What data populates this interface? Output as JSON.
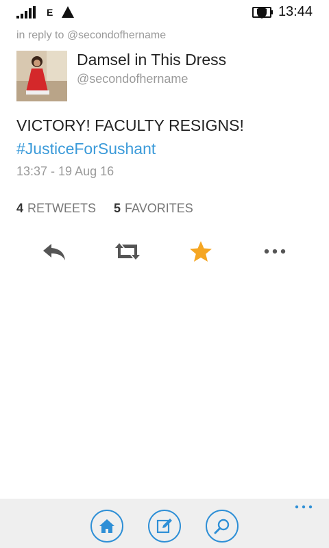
{
  "status_bar": {
    "network_type": "E",
    "time": "13:44",
    "icons": [
      "signal-strength-icon",
      "triangle-icon",
      "shield-battery-icon"
    ]
  },
  "tweet": {
    "in_reply_to": "in reply to @secondofhername",
    "author_name": "Damsel in This Dress",
    "author_handle": "@secondofhername",
    "text": "VICTORY! FACULTY RESIGNS!",
    "hashtag": "#JusticeForSushant",
    "timestamp": "13:37 - 19 Aug 16",
    "retweets_count": "4",
    "retweets_label": "RETWEETS",
    "favorites_count": "5",
    "favorites_label": "FAVORITES"
  },
  "actions": [
    {
      "name": "reply",
      "icon": "reply-icon"
    },
    {
      "name": "retweet",
      "icon": "retweet-icon"
    },
    {
      "name": "favorite",
      "icon": "star-icon",
      "color": "#f5a623"
    },
    {
      "name": "more",
      "icon": "ellipsis-icon"
    }
  ],
  "app_bar": {
    "buttons": [
      "home-icon",
      "compose-icon",
      "search-icon"
    ],
    "accent": "#2e8fd6",
    "more": "ellipsis-icon"
  },
  "colors": {
    "hashtag": "#3a9ad9",
    "secondary_text": "#9a9a9a",
    "favorite": "#f5a623"
  }
}
